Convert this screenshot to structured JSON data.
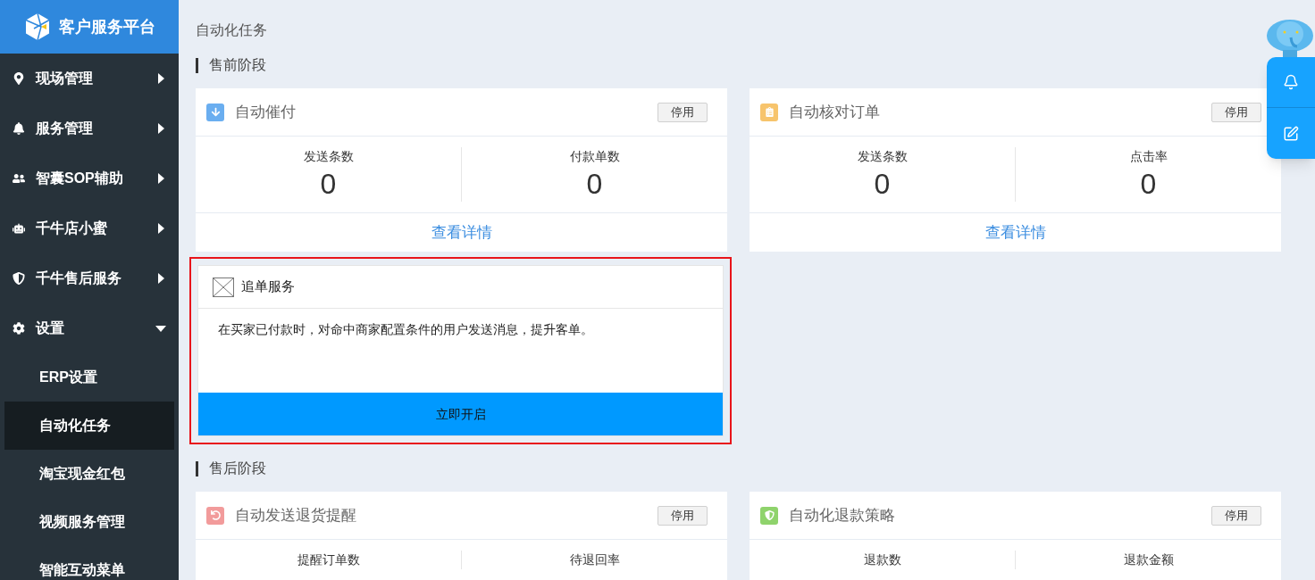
{
  "sidebar": {
    "logo_text": "客户服务平台",
    "items": [
      {
        "label": "现场管理",
        "expanded": false
      },
      {
        "label": "服务管理",
        "expanded": false
      },
      {
        "label": "智囊SOP辅助",
        "expanded": false
      },
      {
        "label": "千牛店小蜜",
        "expanded": false
      },
      {
        "label": "千牛售后服务",
        "expanded": false
      },
      {
        "label": "设置",
        "expanded": true,
        "children": [
          {
            "label": "ERP设置",
            "selected": false
          },
          {
            "label": "自动化任务",
            "selected": true
          },
          {
            "label": "淘宝现金红包",
            "selected": false
          },
          {
            "label": "视频服务管理",
            "selected": false
          },
          {
            "label": "智能互动菜单",
            "selected": false
          }
        ]
      }
    ]
  },
  "page_title": "自动化任务",
  "sections": [
    {
      "title": "售前阶段",
      "cards": [
        {
          "kind": "stats",
          "title": "自动催付",
          "color": "#6aaef0",
          "button": "停用",
          "stats": [
            {
              "label": "发送条数",
              "value": "0"
            },
            {
              "label": "付款单数",
              "value": "0"
            }
          ],
          "link": "查看详情"
        },
        {
          "kind": "stats",
          "title": "自动核对订单",
          "color": "#f7c46c",
          "button": "停用",
          "stats": [
            {
              "label": "发送条数",
              "value": "0"
            },
            {
              "label": "点击率",
              "value": "0"
            }
          ],
          "link": "查看详情"
        },
        {
          "kind": "promo",
          "title": "追单服务",
          "highlighted": true,
          "description": "在买家已付款时，对命中商家配置条件的用户发送消息，提升客单。",
          "button": "立即开启"
        }
      ]
    },
    {
      "title": "售后阶段",
      "cards": [
        {
          "kind": "stats",
          "title": "自动发送退货提醒",
          "color": "#f29b9b",
          "button": "停用",
          "stats": [
            {
              "label": "提醒订单数"
            },
            {
              "label": "待退回率"
            }
          ]
        },
        {
          "kind": "stats",
          "title": "自动化退款策略",
          "color": "#8fd36c",
          "button": "停用",
          "stats": [
            {
              "label": "退款数"
            },
            {
              "label": "退款金额"
            }
          ]
        }
      ]
    }
  ]
}
